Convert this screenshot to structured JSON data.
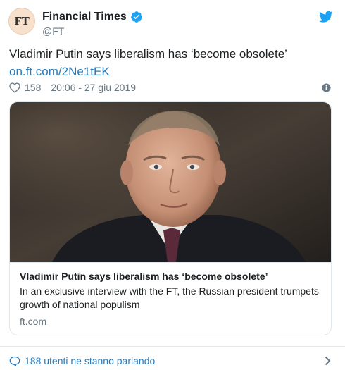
{
  "account": {
    "avatar_text": "FT",
    "name": "Financial Times",
    "handle": "@FT",
    "verified": true
  },
  "tweet": {
    "text": "Vladimir Putin says liberalism has ‘become obsolete’",
    "link": "on.ft.com/2Ne1tEK",
    "likes": "158",
    "timestamp": "20:06 - 27 giu 2019"
  },
  "card": {
    "image_subject": "portrait photo of Vladimir Putin",
    "title": "Vladimir Putin says liberalism has ‘become obsolete’",
    "description": "In an exclusive interview with the FT, the Russian president trumpets growth of national populism",
    "domain": "ft.com"
  },
  "footer": {
    "conversation": "188 utenti ne stanno parlando"
  },
  "icons": {
    "brand": "twitter-bird-icon",
    "verified": "verified-badge-icon",
    "like": "heart-icon",
    "info": "info-icon",
    "reply": "speech-bubble-icon",
    "more": "chevron-right-icon"
  },
  "colors": {
    "link": "#2b7bb9",
    "twitter_blue": "#1da1f2",
    "muted_text": "#697882",
    "border": "#e1e8ed",
    "avatar_bg": "#f7e1cc"
  }
}
